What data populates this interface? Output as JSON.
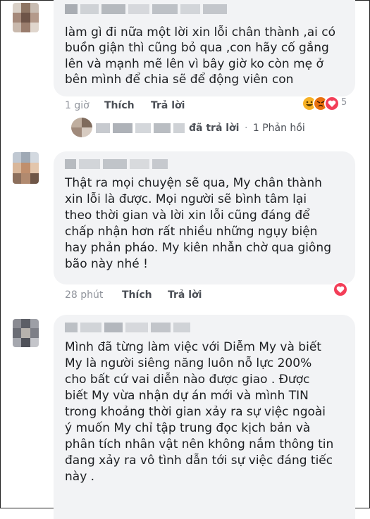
{
  "comments": [
    {
      "lines": [
        "làm gì đi nữa một lời xin lỗi chân thành ,ai có",
        "buồn giận thì cũng bỏ qua ,con hãy cố gắng",
        "lên và mạnh mẽ lên vì bây giờ ko còn mẹ ở",
        "bên mình để chia sẽ để động viên con"
      ],
      "time": "1 giờ",
      "like": "Thích",
      "reply": "Trả lời",
      "reaction_count": "5",
      "reactions": [
        "haha-icon",
        "angry-icon",
        "love-icon"
      ]
    },
    {
      "lines": [
        "Thật ra mọi chuyện sẽ qua, My chân thành",
        "xin lỗi là được. Mọi người sẽ bình tâm lại",
        "theo thời gian và lời xin lỗi cũng đáng để",
        "chấp nhận hơn rất nhiều những ngụy biện",
        "hay phản pháo. My kiên nhẫn chờ qua giông",
        "bão này nhé !"
      ],
      "time": "28 phút",
      "like": "Thích",
      "reply": "Trả lời",
      "reactions": [
        "love-icon"
      ]
    },
    {
      "lines": [
        "Mình đã từng làm việc với Diễm My và biết",
        "My là người siêng năng luôn nỗ lực 200%",
        "cho bất cứ vai diễn nào được giao . Được",
        "biết My vừa nhận dự án mới và mình TIN",
        "trong khoảng thời gian xảy ra sự việc ngoài",
        "ý muốn My chỉ tập trung đọc kịch bản và",
        "phân tích nhân vật nên không nắm thông tin",
        "đang xảy ra vô tình dẫn tới sự việc đáng tiếc",
        "này ."
      ]
    }
  ],
  "reply_summary": {
    "action": "đã trả lời",
    "separator": "·",
    "count": "1 Phản hồi"
  },
  "colors": {
    "bubble": "#f2f3f5",
    "meta": "#90949c",
    "action": "#4b4f56",
    "love": "#f33e58",
    "haha": "#f7b125",
    "angry": "#e9710f"
  }
}
